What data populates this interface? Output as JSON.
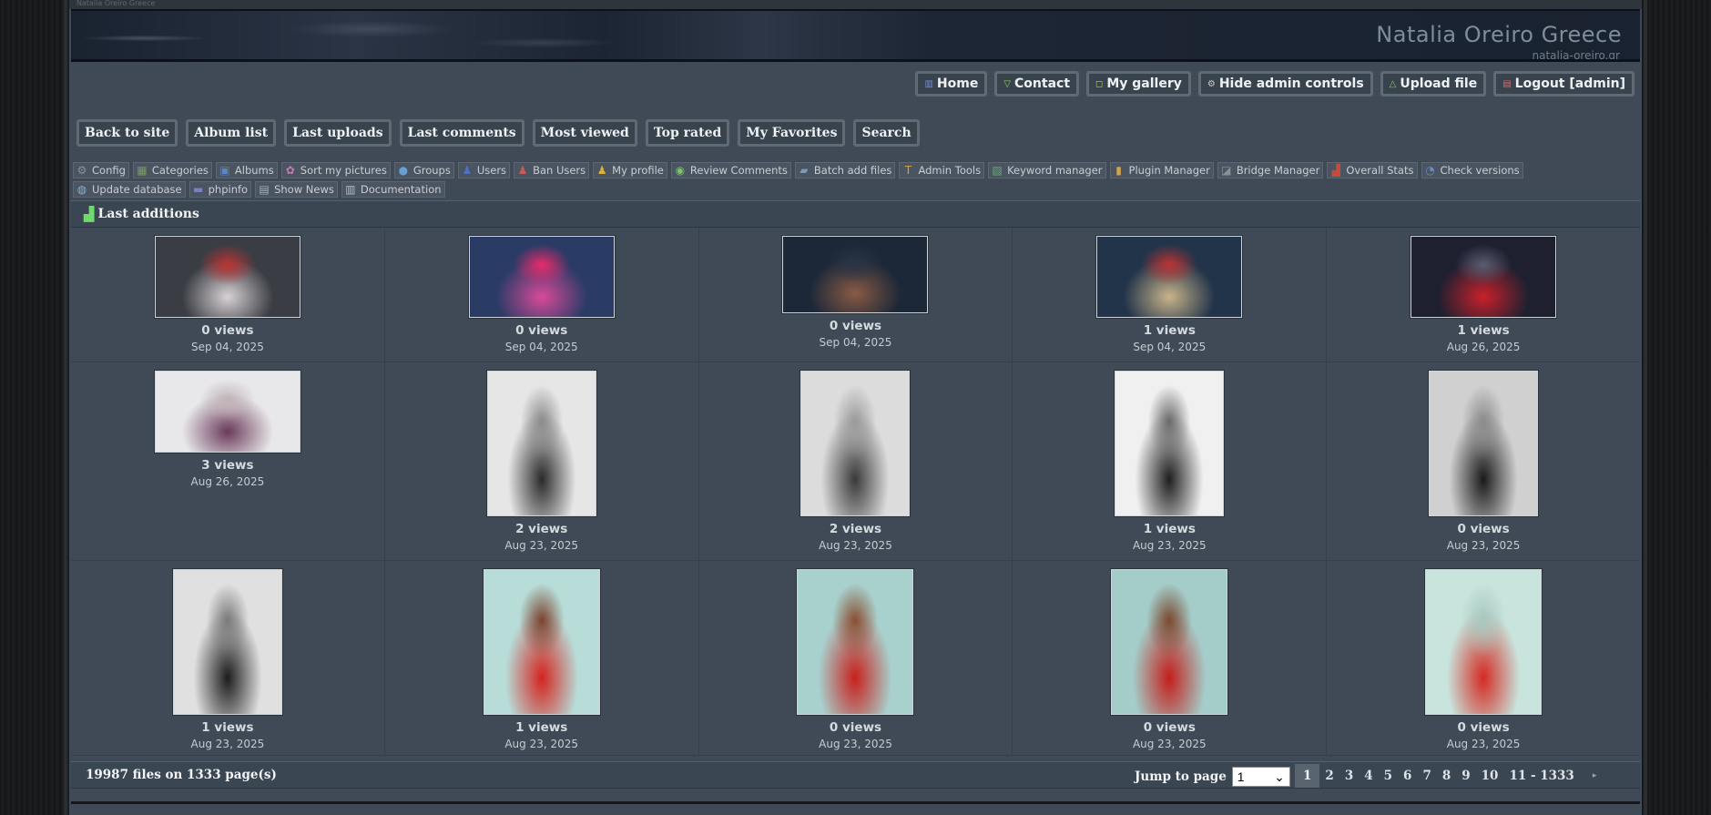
{
  "site": {
    "topstrip_text": "Natalia Oreiro Greece",
    "title": "Natalia Oreiro Greece",
    "subtitle": "natalia-oreiro.gr"
  },
  "top_menu": [
    {
      "label": "Home",
      "icon": "home-icon",
      "glyph": "▥",
      "color": "#6f8fd8"
    },
    {
      "label": "Contact",
      "icon": "contact-icon",
      "glyph": "▽",
      "color": "#8ccf4f"
    },
    {
      "label": "My gallery",
      "icon": "gallery-icon",
      "glyph": "◻",
      "color": "#b6c64a"
    },
    {
      "label": "Hide admin controls",
      "icon": "admin-icon",
      "glyph": "⚙",
      "color": "#c9ced4"
    },
    {
      "label": "Upload file",
      "icon": "upload-icon",
      "glyph": "△",
      "color": "#7fd06a"
    },
    {
      "label": "Logout [admin]",
      "icon": "logout-icon",
      "glyph": "▤",
      "color": "#d86a6a"
    }
  ],
  "main_menu": [
    "Back to site",
    "Album list",
    "Last uploads",
    "Last comments",
    "Most viewed",
    "Top rated",
    "My Favorites",
    "Search"
  ],
  "admin_menu": [
    {
      "label": "Config",
      "icon": "config-icon",
      "glyph": "⚙",
      "bg": "#8a9199"
    },
    {
      "label": "Categories",
      "icon": "categories-icon",
      "glyph": "▦",
      "bg": "#7d9a6a"
    },
    {
      "label": "Albums",
      "icon": "albums-icon",
      "glyph": "▣",
      "bg": "#5f86c4"
    },
    {
      "label": "Sort my pictures",
      "icon": "sort-icon",
      "glyph": "✿",
      "bg": "#c77ab4"
    },
    {
      "label": "Groups",
      "icon": "groups-icon",
      "glyph": "●",
      "bg": "#6a9fd4"
    },
    {
      "label": "Users",
      "icon": "users-icon",
      "glyph": "♟",
      "bg": "#4d71c9"
    },
    {
      "label": "Ban Users",
      "icon": "ban-users-icon",
      "glyph": "♟",
      "bg": "#c95a5a"
    },
    {
      "label": "My profile",
      "icon": "profile-icon",
      "glyph": "♟",
      "bg": "#d8b23a"
    },
    {
      "label": "Review Comments",
      "icon": "comments-icon",
      "glyph": "◉",
      "bg": "#7bc46a"
    },
    {
      "label": "Batch add files",
      "icon": "batch-icon",
      "glyph": "▰",
      "bg": "#7a9ac0"
    },
    {
      "label": "Admin Tools",
      "icon": "tools-icon",
      "glyph": "T",
      "bg": "#d4a23a"
    },
    {
      "label": "Keyword manager",
      "icon": "keyword-icon",
      "glyph": "▧",
      "bg": "#6aa87a"
    },
    {
      "label": "Plugin Manager",
      "icon": "plugin-icon",
      "glyph": "▮",
      "bg": "#d4a44a"
    },
    {
      "label": "Bridge Manager",
      "icon": "bridge-icon",
      "glyph": "◪",
      "bg": "#8a8f96"
    },
    {
      "label": "Overall Stats",
      "icon": "stats-icon",
      "glyph": "▟",
      "bg": "#c94a3a"
    },
    {
      "label": "Check versions",
      "icon": "versions-icon",
      "glyph": "◔",
      "bg": "#6a8fc4"
    },
    {
      "label": "Update database",
      "icon": "database-icon",
      "glyph": "◍",
      "bg": "#8ab0d0"
    },
    {
      "label": "phpinfo",
      "icon": "phpinfo-icon",
      "glyph": "▬",
      "bg": "#7d7fc4"
    },
    {
      "label": "Show News",
      "icon": "news-icon",
      "glyph": "▤",
      "bg": "#a8b0b8"
    },
    {
      "label": "Documentation",
      "icon": "documentation-icon",
      "glyph": "▥",
      "bg": "#b8bec4"
    }
  ],
  "gallery": {
    "heading": "Last additions",
    "rows": [
      [
        {
          "views": "0 views",
          "date": "Sep 04, 2025",
          "shape": "landscape",
          "palette": [
            "#3a3d44",
            "#d8d2d4",
            "#b33"
          ]
        },
        {
          "views": "0 views",
          "date": "Sep 04, 2025",
          "shape": "landscape",
          "palette": [
            "#2a3b66",
            "#d84a9a",
            "#e82a6a"
          ]
        },
        {
          "views": "0 views",
          "date": "Sep 04, 2025",
          "shape": "landscape-short",
          "palette": [
            "#1c2838",
            "#8a5a44",
            "#2a3446"
          ]
        },
        {
          "views": "1 views",
          "date": "Sep 04, 2025",
          "shape": "landscape",
          "palette": [
            "#22344a",
            "#c8b48a",
            "#b33"
          ]
        },
        {
          "views": "1 views",
          "date": "Aug 26, 2025",
          "shape": "landscape",
          "palette": [
            "#1e2030",
            "#c8202a",
            "#5a5c70"
          ]
        }
      ],
      [
        {
          "views": "3 views",
          "date": "Aug 26, 2025",
          "shape": "landscape",
          "palette": [
            "#e8e8ea",
            "#6a3a5a",
            "#c0b4b8"
          ]
        },
        {
          "views": "2 views",
          "date": "Aug 23, 2025",
          "shape": "portrait",
          "palette": [
            "#e6e6e6",
            "#2a2a2a",
            "#8a8a8a"
          ]
        },
        {
          "views": "2 views",
          "date": "Aug 23, 2025",
          "shape": "portrait",
          "palette": [
            "#dcdcdc",
            "#3a3a3a",
            "#9a9a9a"
          ]
        },
        {
          "views": "1 views",
          "date": "Aug 23, 2025",
          "shape": "portrait",
          "palette": [
            "#f0f0f0",
            "#1e1e1e",
            "#6a6a6a"
          ]
        },
        {
          "views": "0 views",
          "date": "Aug 23, 2025",
          "shape": "portrait",
          "palette": [
            "#d0d0d0",
            "#1a1a1a",
            "#8a8a8a"
          ]
        }
      ],
      [
        {
          "views": "1 views",
          "date": "Aug 23, 2025",
          "shape": "portrait",
          "palette": [
            "#e0e0e0",
            "#1c1c1c",
            "#7a7a7a"
          ]
        },
        {
          "views": "1 views",
          "date": "Aug 23, 2025",
          "shape": "portrait-wide",
          "palette": [
            "#b8dcd8",
            "#d4241e",
            "#7a4430"
          ]
        },
        {
          "views": "0 views",
          "date": "Aug 23, 2025",
          "shape": "portrait-wide",
          "palette": [
            "#a8d0cc",
            "#c8201c",
            "#8a5034"
          ]
        },
        {
          "views": "0 views",
          "date": "Aug 23, 2025",
          "shape": "portrait-wide",
          "palette": [
            "#a4ccc8",
            "#c41e1a",
            "#7a4a30"
          ]
        },
        {
          "views": "0 views",
          "date": "Aug 23, 2025",
          "shape": "portrait-wide",
          "palette": [
            "#c8e4dc",
            "#d42a22",
            "#a8c8c0"
          ]
        }
      ]
    ]
  },
  "footer": {
    "count": "19987 files on 1333 page(s)",
    "jump_label": "Jump to page",
    "jump_value": "1",
    "pages": [
      "1",
      "2",
      "3",
      "4",
      "5",
      "6",
      "7",
      "8",
      "9",
      "10",
      "11 - 1333"
    ],
    "current_page": "1",
    "next_glyph": "▸"
  }
}
